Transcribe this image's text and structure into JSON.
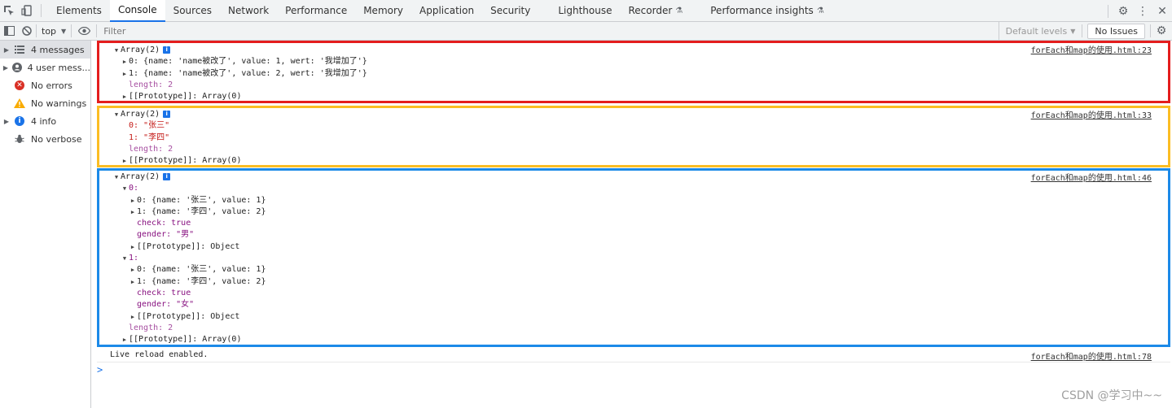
{
  "tabs": [
    "Elements",
    "Console",
    "Sources",
    "Network",
    "Performance",
    "Memory",
    "Application",
    "Security",
    "Lighthouse",
    "Recorder",
    "Performance insights"
  ],
  "active_tab": "Console",
  "toolbar": {
    "context": "top",
    "filter_placeholder": "Filter",
    "levels": "Default levels",
    "issues": "No Issues"
  },
  "sidebar": {
    "items": [
      {
        "label": "4 messages",
        "icon": "list-icon"
      },
      {
        "label": "4 user mess...",
        "icon": "user-icon"
      },
      {
        "label": "No errors",
        "icon": "error-icon"
      },
      {
        "label": "No warnings",
        "icon": "warning-icon"
      },
      {
        "label": "4 info",
        "icon": "info-icon"
      },
      {
        "label": "No verbose",
        "icon": "bug-icon"
      }
    ]
  },
  "messages": {
    "m1": {
      "src": "forEach和map的使用.html:23",
      "header": "Array(2)",
      "l1": "0: {name: 'name被改了', value: 1, wert: '我增加了'}",
      "l2": "1: {name: 'name被改了', value: 2, wert: '我增加了'}",
      "l3": "length: 2",
      "l4": "[[Prototype]]: Array(0)"
    },
    "m2": {
      "src": "forEach和map的使用.html:33",
      "header": "Array(2)",
      "l1": "0: \"张三\"",
      "l2": "1: \"李四\"",
      "l3": "length: 2",
      "l4": "[[Prototype]]: Array(0)"
    },
    "m3": {
      "src": "forEach和map的使用.html:46",
      "header": "Array(2)",
      "l1": "0:",
      "l2": "0: {name: '张三', value: 1}",
      "l3": "1: {name: '李四', value: 2}",
      "l4": "check: true",
      "l5": "gender: \"男\"",
      "l6": "[[Prototype]]: Object",
      "l7": "1:",
      "l8": "0: {name: '张三', value: 1}",
      "l9": "1: {name: '李四', value: 2}",
      "l10": "check: true",
      "l11": "gender: \"女\"",
      "l12": "[[Prototype]]: Object",
      "l13": "length: 2",
      "l14": "[[Prototype]]: Array(0)"
    },
    "m4": {
      "src": "forEach和map的使用.html:78",
      "text": "Live reload enabled."
    }
  },
  "watermark": "CSDN @学习中~~",
  "prompt": ">"
}
